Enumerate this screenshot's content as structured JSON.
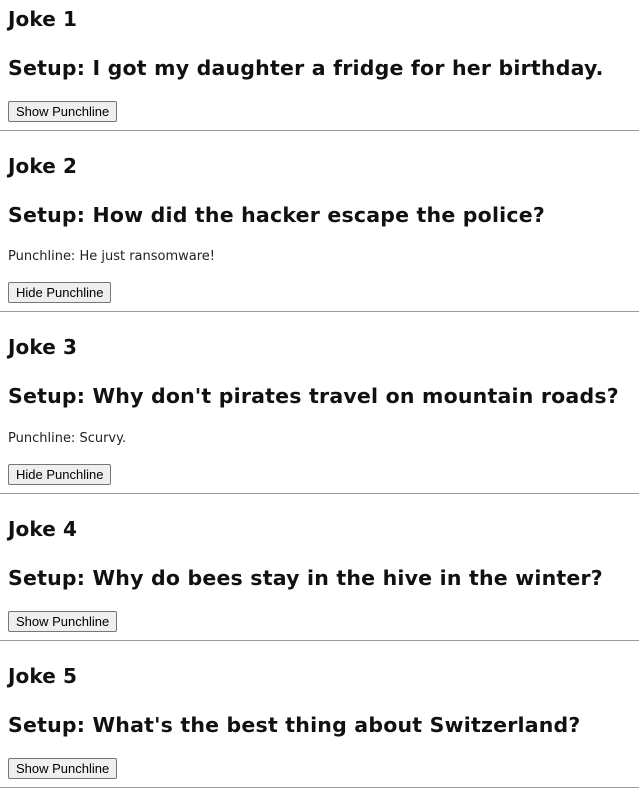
{
  "jokes": [
    {
      "title": "Joke 1",
      "setup": "Setup: I got my daughter a fridge for her birthday.",
      "punchline": "",
      "button_label": "Show Punchline"
    },
    {
      "title": "Joke 2",
      "setup": "Setup: How did the hacker escape the police?",
      "punchline": "Punchline: He just ransomware!",
      "button_label": "Hide Punchline"
    },
    {
      "title": "Joke 3",
      "setup": "Setup: Why don't pirates travel on mountain roads?",
      "punchline": "Punchline: Scurvy.",
      "button_label": "Hide Punchline"
    },
    {
      "title": "Joke 4",
      "setup": "Setup: Why do bees stay in the hive in the winter?",
      "punchline": "",
      "button_label": "Show Punchline"
    },
    {
      "title": "Joke 5",
      "setup": "Setup: What's the best thing about Switzerland?",
      "punchline": "",
      "button_label": "Show Punchline"
    }
  ]
}
